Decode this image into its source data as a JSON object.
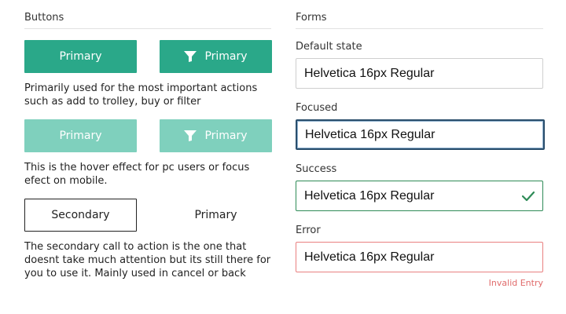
{
  "buttons_section": {
    "title": "Buttons",
    "primary_label": "Primary",
    "primary_filter_label": "Primary",
    "primary_desc": "Primarily used for the most important actions such as add to trolley, buy  or filter",
    "hover_label": "Primary",
    "hover_filter_label": "Primary",
    "hover_desc": "This is the hover effect for pc users or focus efect on mobile.",
    "secondary_label": "Secondary",
    "text_button_label": "Primary",
    "secondary_desc": "The secondary call to action is the one that doesnt take much attention but its still there for you to use it. Mainly used in cancel or back"
  },
  "forms_section": {
    "title": "Forms",
    "default": {
      "label": "Default state",
      "value": "Helvetica 16px Regular"
    },
    "focused": {
      "label": "Focused",
      "value": "Helvetica 16px Regular"
    },
    "success": {
      "label": "Success",
      "value": "Helvetica 16px Regular"
    },
    "error": {
      "label": "Error",
      "value": "Helvetica 16px Regular",
      "message": "Invalid Entry"
    }
  },
  "colors": {
    "primary": "#2aa889",
    "hover": "#7fd0bd",
    "focus_border": "#2a4e6c",
    "success": "#2e8b57",
    "error": "#e98080"
  },
  "icons": [
    "filter-icon",
    "check-icon"
  ]
}
